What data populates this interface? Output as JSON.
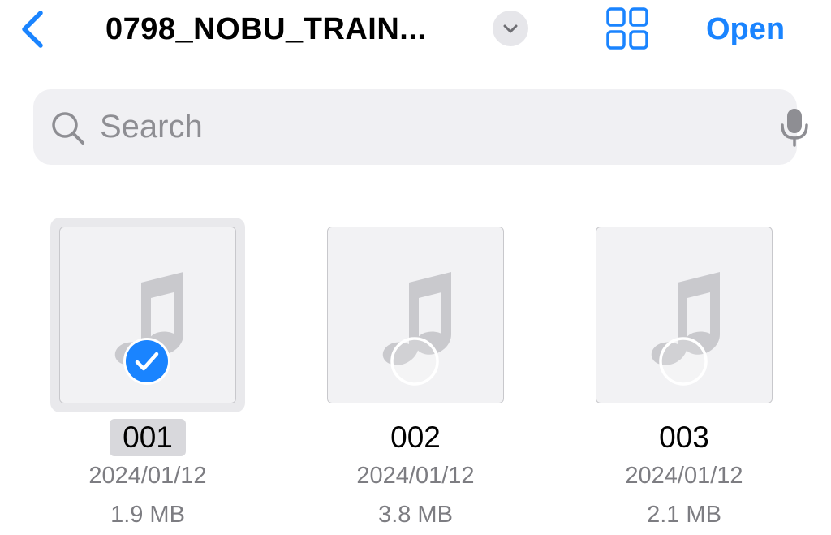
{
  "header": {
    "back_icon": "chevron-left-icon",
    "title": "0798_NOBU_TRAIN...",
    "menu_icon": "chevron-down-icon",
    "view_icon": "grid-icon",
    "open_label": "Open",
    "accent_color": "#1a84ff"
  },
  "search": {
    "placeholder": "Search",
    "value": "",
    "search_icon": "magnifying-glass-icon",
    "mic_icon": "microphone-icon"
  },
  "files": [
    {
      "name": "001",
      "date": "2024/01/12",
      "size": "1.9 MB",
      "selected": true,
      "icon": "music-note-icon"
    },
    {
      "name": "002",
      "date": "2024/01/12",
      "size": "3.8 MB",
      "selected": false,
      "icon": "music-note-icon"
    },
    {
      "name": "003",
      "date": "2024/01/12",
      "size": "2.1 MB",
      "selected": false,
      "icon": "music-note-icon"
    }
  ]
}
